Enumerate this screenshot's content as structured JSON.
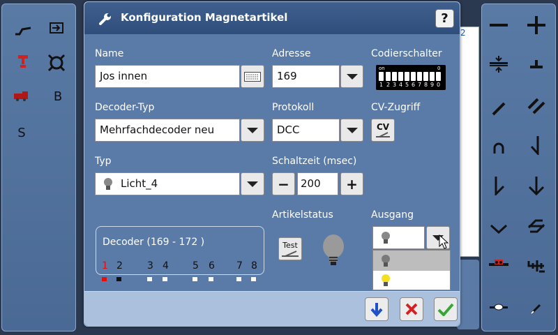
{
  "dialog": {
    "title": "Konfiguration Magnetartikel",
    "help_label": "?"
  },
  "left_toolbar": {
    "letters": {
      "b": "B",
      "s": "S"
    }
  },
  "fields": {
    "name": {
      "label": "Name",
      "value": "Jos innen"
    },
    "adresse": {
      "label": "Adresse",
      "value": "169"
    },
    "codierschalter": {
      "label": "Codierschalter",
      "on_label": "on",
      "zero_label": "0",
      "numbers": [
        "1",
        "2",
        "3",
        "4",
        "5",
        "6",
        "7",
        "8",
        "9",
        "0"
      ]
    },
    "decoder_typ": {
      "label": "Decoder-Typ",
      "value": "Mehrfachdecoder neu"
    },
    "protokoll": {
      "label": "Protokoll",
      "value": "DCC"
    },
    "cv_zugriff": {
      "label": "CV-Zugriff",
      "button": "CV"
    },
    "typ": {
      "label": "Typ",
      "value": "Licht_4"
    },
    "schaltzeit": {
      "label": "Schaltzeit (msec)",
      "value": "200",
      "minus": "−",
      "plus": "+"
    },
    "artikelstatus": {
      "label": "Artikelstatus",
      "test_label": "Test"
    },
    "ausgang": {
      "label": "Ausgang"
    }
  },
  "decoder": {
    "title": "Decoder (169 - 172 )",
    "outputs": [
      {
        "num": "1",
        "active": true
      },
      {
        "num": "2",
        "active": false
      },
      {
        "num": "3",
        "active": false
      },
      {
        "num": "4",
        "active": false
      },
      {
        "num": "5",
        "active": false
      },
      {
        "num": "6",
        "active": false
      },
      {
        "num": "7",
        "active": false
      },
      {
        "num": "8",
        "active": false
      }
    ]
  },
  "background": {
    "list_fragment": "2"
  },
  "colors": {
    "dialog": "#5a7ba8",
    "titlebar": "#2f4e7c",
    "footer": "#aac0dc",
    "ok_green": "#33a833",
    "cancel_red": "#d42020",
    "down_blue": "#2050c8",
    "active_output": "#e01010"
  }
}
